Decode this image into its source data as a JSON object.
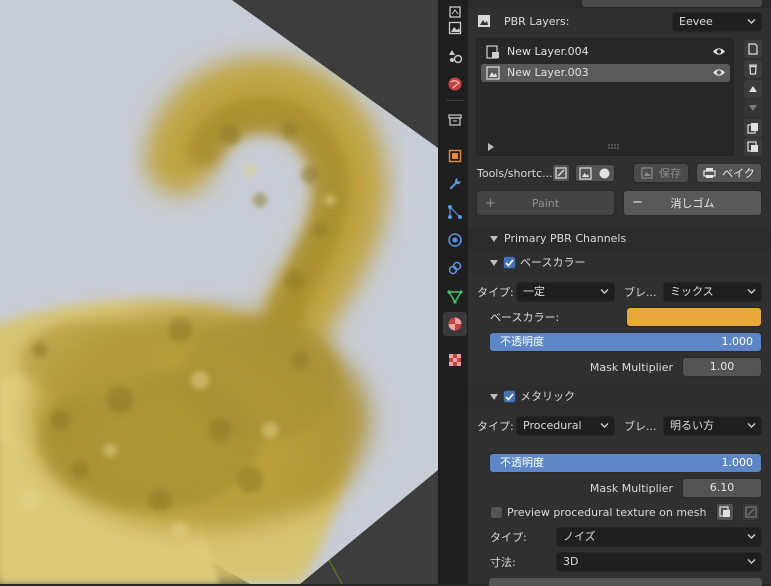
{
  "pbr_layers": {
    "label": "PBR Layers:",
    "engine": "Eevee",
    "layers": [
      {
        "name": "New Layer.004",
        "selected": false
      },
      {
        "name": "New Layer.003",
        "selected": true
      }
    ]
  },
  "tools": {
    "label": "Tools/shortc...",
    "save_label": "保存",
    "bake_label": "ベイク",
    "paint_label": "Paint",
    "erase_label": "消しゴム"
  },
  "primary_channels": {
    "header": "Primary PBR Channels",
    "base_color": {
      "label": "ベースカラー",
      "enabled": true,
      "type_label": "タイプ:",
      "type_value": "一定",
      "blend_label": "ブレ...",
      "blend_value": "ミックス",
      "color_label": "ベースカラー:",
      "color_hex": "#e8a93a",
      "opacity_label": "不透明度",
      "opacity_value": "1.000",
      "mask_label": "Mask Multiplier",
      "mask_value": "1.00"
    },
    "metallic": {
      "label": "メタリック",
      "enabled": true,
      "type_label": "タイプ:",
      "type_value": "Procedural",
      "blend_label": "ブレ...",
      "blend_value": "明るい方",
      "opacity_label": "不透明度",
      "opacity_value": "1.000",
      "mask_label": "Mask Multiplier",
      "mask_value": "6.10",
      "preview_label": "Preview procedural texture on mesh",
      "preview_checked": false,
      "noise_type_label": "タイプ:",
      "noise_type_value": "ノイズ",
      "dim_label": "寸法:",
      "dim_value": "3D"
    }
  },
  "colors": {
    "accent": "#4772b3",
    "slider": "#5c86c5",
    "panel_bg": "#303030",
    "paint_color": "#e8a93a"
  }
}
